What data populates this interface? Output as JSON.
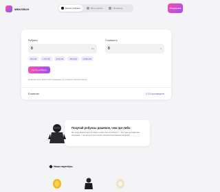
{
  "header": {
    "logo_text": "MBKSBUX",
    "tabs": [
      {
        "label": "Купить робуксы",
        "icon": "cart-icon",
        "active": true
      },
      {
        "label": "Мои покупки",
        "icon": "chat-icon",
        "active": false
      },
      {
        "label": "Промокод",
        "icon": "ticket-icon",
        "active": false
      }
    ],
    "support_label": "Поддержка"
  },
  "purchase": {
    "robux_label": "Робуксы",
    "robux_value": "0",
    "robux_unit": "R$",
    "cost_label": "Стоимость",
    "cost_value": "0",
    "cost_unit": "₽",
    "presets": [
      "800 R$",
      "1700 R$",
      "2200 R$",
      "4500 R$",
      "10000 R$"
    ],
    "buy_label": "Купить робуксы",
    "hint": "Комиссия налог Roblox 30% применяется к стоимости игровой покупки",
    "stock_label": "В наличии:",
    "stock_value": "5 113 производств"
  },
  "promo": {
    "title": "Покупай робуксы дешевле, чем где-либо",
    "text": "Мы предлагаем одни из самых низких цен на робуксы — быстрая доставка без ожидания, с так же круглосуточной и автоматизированной выдачей"
  },
  "partners": {
    "title": "Наши партнёры"
  },
  "colors": {
    "accent": "#7a4fd6",
    "gradient_start": "#ff4fa3",
    "gradient_end": "#a24bff",
    "background": "#f4f4f6"
  }
}
